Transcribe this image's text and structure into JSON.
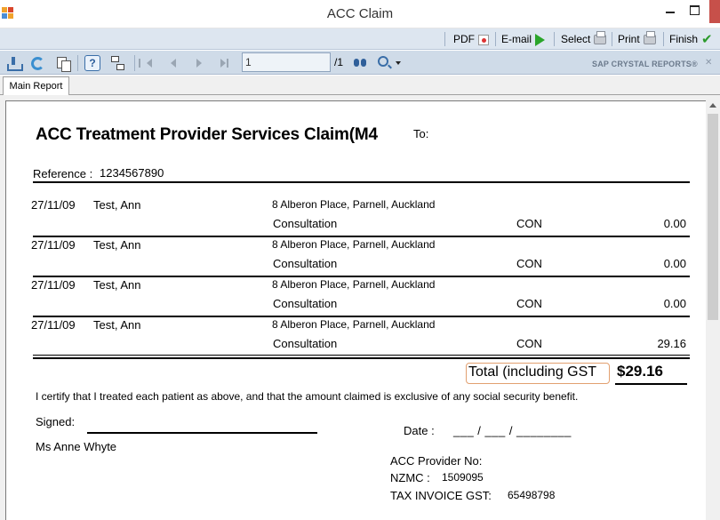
{
  "window": {
    "title": "ACC Claim"
  },
  "action_toolbar": {
    "pdf_label": "PDF",
    "email_label": "E-mail",
    "select_label": "Select",
    "print_label": "Print",
    "finish_label": "Finish"
  },
  "viewer_toolbar": {
    "page_input_value": "1",
    "page_total": "/1",
    "brand": "SAP CRYSTAL REPORTS®"
  },
  "tabs": [
    {
      "label": "Main Report"
    }
  ],
  "report": {
    "title": "ACC Treatment Provider Services Claim(M4",
    "to_label": "To:",
    "reference_label": "Reference :",
    "reference_value": "1234567890",
    "rows": [
      {
        "date": "27/11/09",
        "name": "Test, Ann",
        "address": "8 Alberon Place, Parnell, Auckland",
        "service": "Consultation",
        "code": "CON",
        "amount": "0.00"
      },
      {
        "date": "27/11/09",
        "name": "Test, Ann",
        "address": "8 Alberon Place, Parnell, Auckland",
        "service": "Consultation",
        "code": "CON",
        "amount": "0.00"
      },
      {
        "date": "27/11/09",
        "name": "Test, Ann",
        "address": "8 Alberon Place, Parnell, Auckland",
        "service": "Consultation",
        "code": "CON",
        "amount": "0.00"
      },
      {
        "date": "27/11/09",
        "name": "Test, Ann",
        "address": "8 Alberon Place, Parnell, Auckland",
        "service": "Consultation",
        "code": "CON",
        "amount": "29.16"
      }
    ],
    "total_label": "Total (including GST",
    "total_value": "$29.16",
    "certify_text": "I certify that I treated each patient as above, and that the amount claimed is exclusive of any social security benefit.",
    "signed_label": "Signed:",
    "signer_name": "Ms Anne Whyte",
    "date_label": "Date :",
    "date_blanks": "___ / ___ / ________",
    "provider_label": "ACC Provider No:",
    "nzmc_label": "NZMC :",
    "nzmc_value": "1509095",
    "gst_label": "TAX INVOICE GST:",
    "gst_value": "65498798"
  }
}
